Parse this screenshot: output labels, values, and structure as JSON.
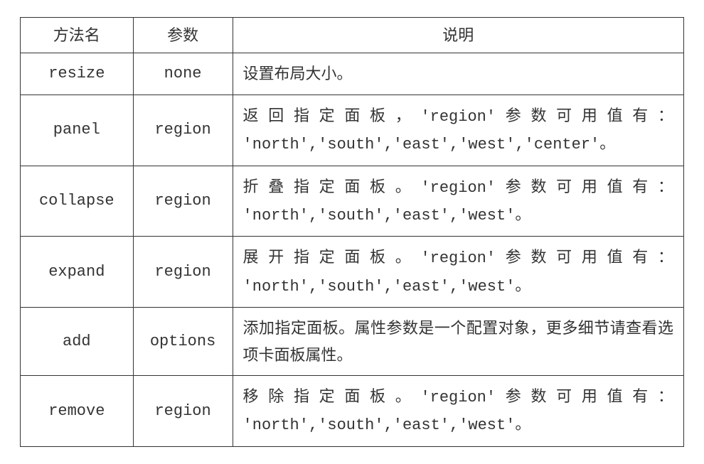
{
  "headers": {
    "method": "方法名",
    "param": "参数",
    "desc": "说明"
  },
  "rows": [
    {
      "method": "resize",
      "param": "none",
      "desc_plain": "设置布局大小。",
      "desc_lines": null
    },
    {
      "method": "panel",
      "param": "region",
      "desc_lines": [
        {
          "justify": true,
          "segments": [
            {
              "t": "返回指定面板，",
              "code": false
            },
            {
              "t": "'region'",
              "code": true
            },
            {
              "t": "参数可用值有：",
              "code": false
            }
          ]
        },
        {
          "justify": false,
          "segments": [
            {
              "t": "'north','south','east','west','center'",
              "code": true
            },
            {
              "t": "。",
              "code": false
            }
          ]
        }
      ]
    },
    {
      "method": "collapse",
      "param": "region",
      "desc_lines": [
        {
          "justify": true,
          "segments": [
            {
              "t": "折叠指定面板。",
              "code": false
            },
            {
              "t": "'region'",
              "code": true
            },
            {
              "t": "参数可用值有：",
              "code": false
            }
          ]
        },
        {
          "justify": false,
          "segments": [
            {
              "t": "'north','south','east','west'",
              "code": true
            },
            {
              "t": "。",
              "code": false
            }
          ]
        }
      ]
    },
    {
      "method": "expand",
      "param": "region",
      "desc_lines": [
        {
          "justify": true,
          "segments": [
            {
              "t": "展开指定面板。",
              "code": false
            },
            {
              "t": "'region'",
              "code": true
            },
            {
              "t": "参数可用值有：",
              "code": false
            }
          ]
        },
        {
          "justify": false,
          "segments": [
            {
              "t": "'north','south','east','west'",
              "code": true
            },
            {
              "t": "。",
              "code": false
            }
          ]
        }
      ]
    },
    {
      "method": "add",
      "param": "options",
      "desc_plain": "添加指定面板。属性参数是一个配置对象，更多细节请查看选项卡面板属性。",
      "desc_lines": null
    },
    {
      "method": "remove",
      "param": "region",
      "desc_lines": [
        {
          "justify": true,
          "segments": [
            {
              "t": "移除指定面板。",
              "code": false
            },
            {
              "t": "'region'",
              "code": true
            },
            {
              "t": "参数可用值有：",
              "code": false
            }
          ]
        },
        {
          "justify": false,
          "segments": [
            {
              "t": "'north','south','east','west'",
              "code": true
            },
            {
              "t": "。",
              "code": false
            }
          ]
        }
      ]
    }
  ]
}
